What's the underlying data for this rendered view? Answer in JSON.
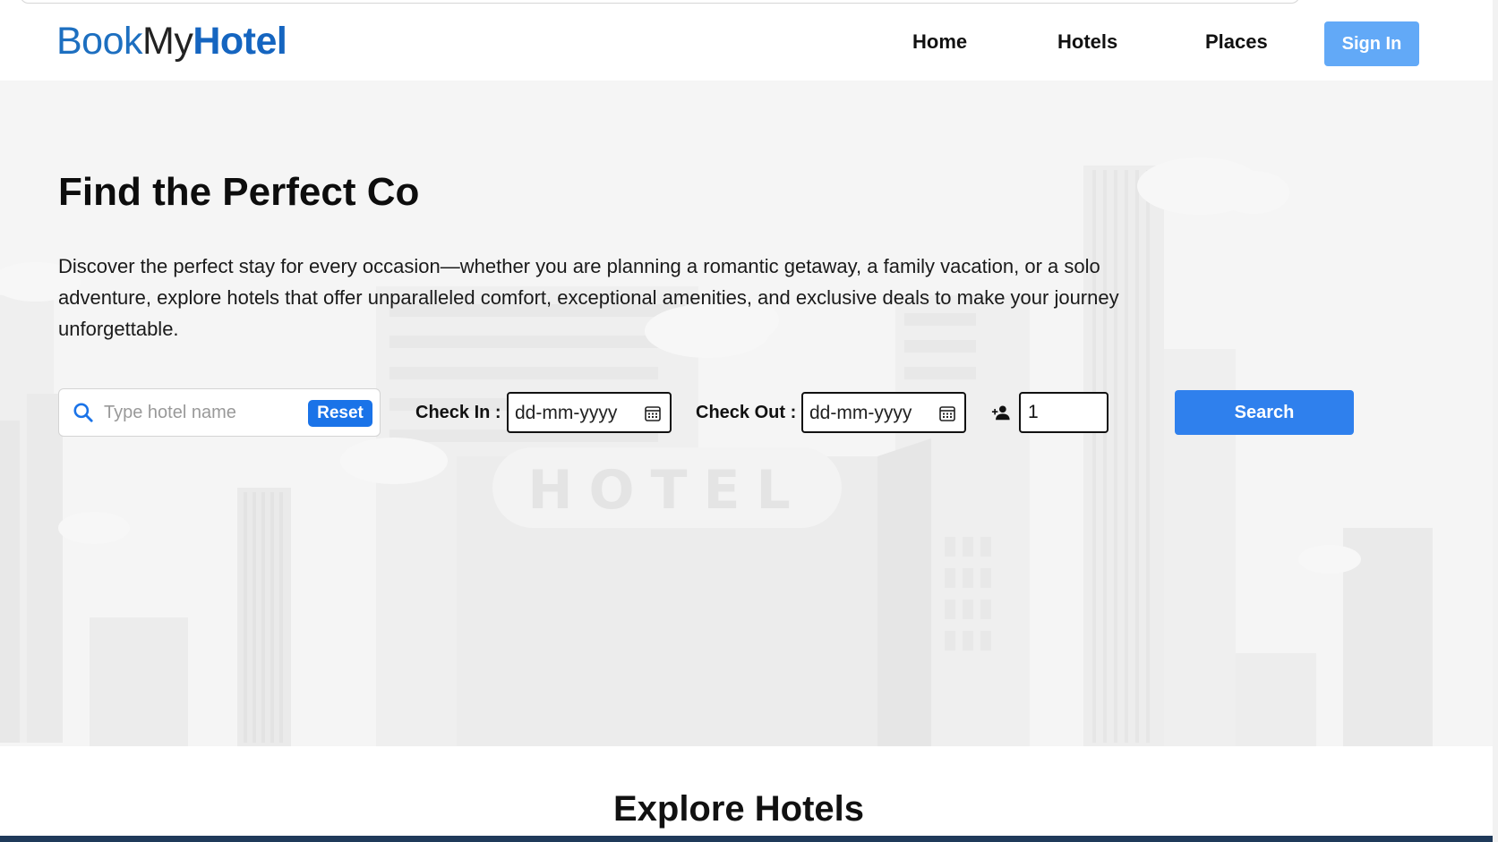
{
  "brand": {
    "part1": "Book",
    "part2": "My",
    "part3": "Hotel",
    "colors": {
      "accent": "#1565c0",
      "dark": "#222222"
    }
  },
  "nav": {
    "items": [
      "Home",
      "Hotels",
      "Places"
    ],
    "signin_label": "Sign In",
    "signin_color": "#62a9f7"
  },
  "hero": {
    "title": "Find the Perfect Co",
    "description": "Discover the perfect stay for every occasion—whether you are planning a romantic getaway, a family vacation, or a solo adventure, explore hotels that offer unparalleled comfort, exceptional amenities, and exclusive deals to make your journey unforgettable.",
    "background_sign": "HOTEL"
  },
  "search": {
    "placeholder": "Type hotel name",
    "reset_label": "Reset",
    "checkin_label": "Check In :",
    "checkin_value": "dd-mm-yyyy",
    "checkout_label": "Check Out :",
    "checkout_value": "dd-mm-yyyy",
    "guests_value": "1",
    "search_label": "Search",
    "search_color": "#2f80ed"
  },
  "icons": {
    "search": "search-icon",
    "calendar": "calendar-icon",
    "guest": "add-person-icon"
  },
  "sections": {
    "explore_title": "Explore Hotels"
  }
}
